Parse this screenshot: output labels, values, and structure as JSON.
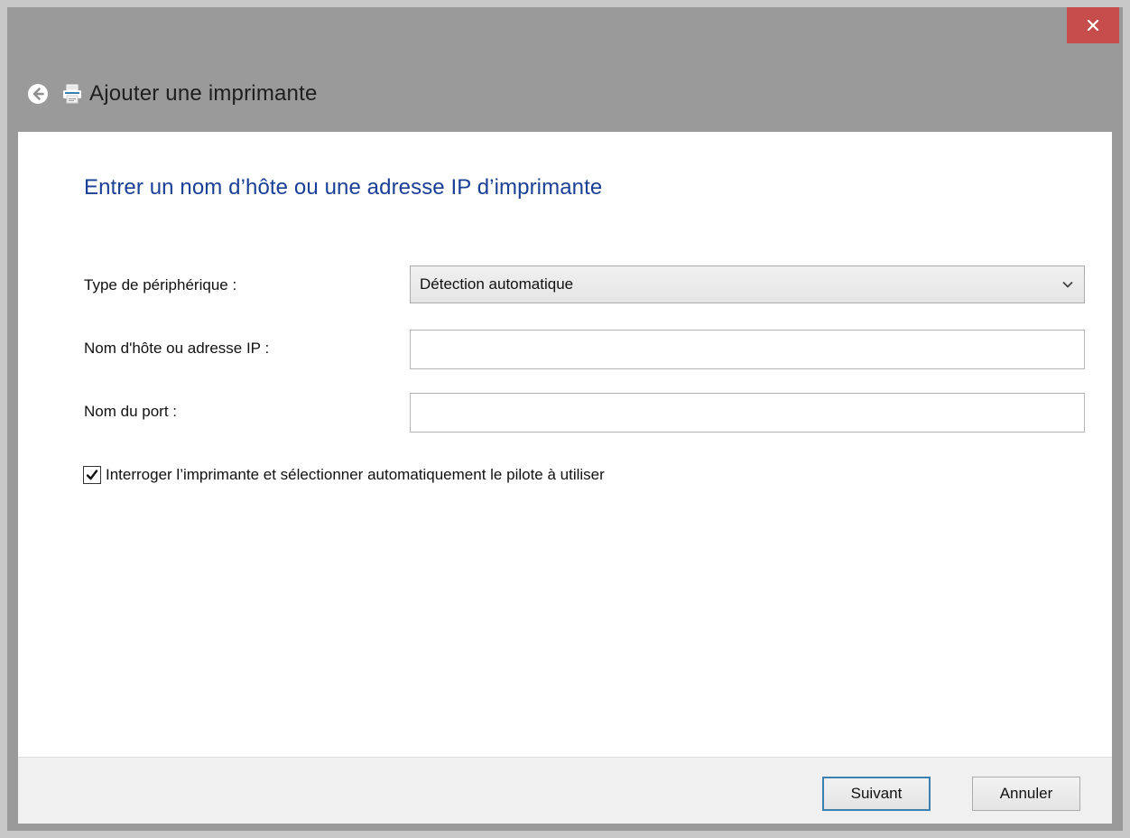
{
  "window": {
    "title": "Ajouter une imprimante",
    "close_symbol": "×"
  },
  "icons": {
    "back": "back-arrow-icon",
    "printer": "printer-icon",
    "close": "close-icon",
    "dropdown": "chevron-down-icon",
    "checkmark": "checkmark-icon"
  },
  "page": {
    "heading": "Entrer un nom d’hôte ou une adresse IP d’imprimante"
  },
  "form": {
    "device_type": {
      "label": "Type de périphérique :",
      "selected": "Détection automatique"
    },
    "hostname": {
      "label": "Nom d'hôte ou adresse IP :",
      "value": ""
    },
    "port": {
      "label": "Nom du port :",
      "value": ""
    },
    "query_printer": {
      "label": "Interroger l’imprimante et sélectionner automatiquement le pilote à utiliser",
      "checked": true
    }
  },
  "footer": {
    "next_label": "Suivant",
    "cancel_label": "Annuler"
  },
  "colors": {
    "heading": "#1a3f96",
    "close_button": "#c74d4d",
    "frame": "#9a9a9a",
    "default_button_border": "#3c7fb1"
  }
}
